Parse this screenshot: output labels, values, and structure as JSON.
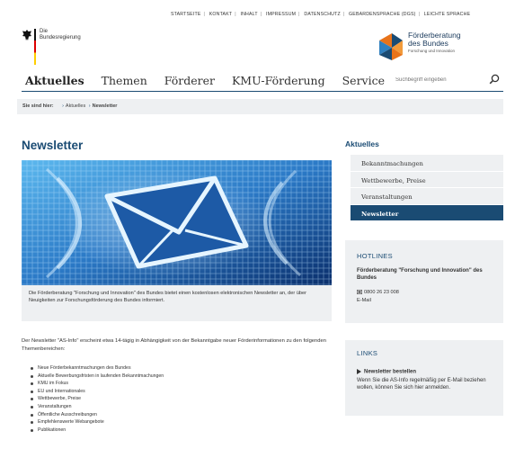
{
  "meta_nav": [
    "Startseite",
    "Kontakt",
    "Inhalt",
    "Impressum",
    "Datenschutz",
    "Gebärdensprache (DGS)",
    "Leichte Sprache"
  ],
  "logo_left": {
    "line1": "Die",
    "line2": "Bundesregierung"
  },
  "logo_right": {
    "line1": "Förderberatung",
    "line2": "des Bundes",
    "sub": "Forschung und Innovation"
  },
  "main_nav": [
    "Aktuelles",
    "Themen",
    "Förderer",
    "KMU-Förderung",
    "Service"
  ],
  "search": {
    "placeholder": "Suchbegriff eingeben"
  },
  "breadcrumb": {
    "label": "Sie sind hier:",
    "items": [
      "Aktuelles",
      "Newsletter"
    ]
  },
  "page": {
    "title": "Newsletter",
    "caption": "Die Förderberatung \"Forschung und Innovation\" des Bundes bietet einen kostenlosen elektronischen Newsletter an, der über Neuigkeiten zur Forschungsförderung des Bundes informiert.",
    "intro": "Der Newsletter \"AS-Info\" erscheint etwa 14-tägig in Abhängigkeit von der Bekanntgabe neuer Förderinformationen zu den folgenden Themenbereichen:",
    "topics": [
      "Neue Förderbekanntmachungen des Bundes",
      "Aktuelle Bewerbungsfristen in laufenden Bekanntmachungen",
      "KMU im Fokus",
      "EU und Internationales",
      "Wettbewerbe, Preise",
      "Veranstaltungen",
      "Öffentliche Ausschreibungen",
      "Empfehlenswerte Webangebote",
      "Publikationen"
    ]
  },
  "sidebar": {
    "title": "Aktuelles",
    "items": [
      "Bekanntmachungen",
      "Wettbewerbe, Preise",
      "Veranstaltungen",
      "Newsletter"
    ],
    "active_index": 3
  },
  "hotlines": {
    "title": "HOTLINES",
    "name": "Förderberatung \"Forschung und Innovation\" des Bundes",
    "phone": "0800 26 23 008",
    "email": "E-Mail"
  },
  "links": {
    "title": "LINKS",
    "link_label": "Newsletter bestellen",
    "text": "Wenn Sie die AS-Info regelmäßig per E-Mail beziehen wollen, können Sie sich hier anmelden."
  },
  "colors": {
    "brand_blue": "#1a4b73",
    "panel_gray": "#eef0f2"
  }
}
